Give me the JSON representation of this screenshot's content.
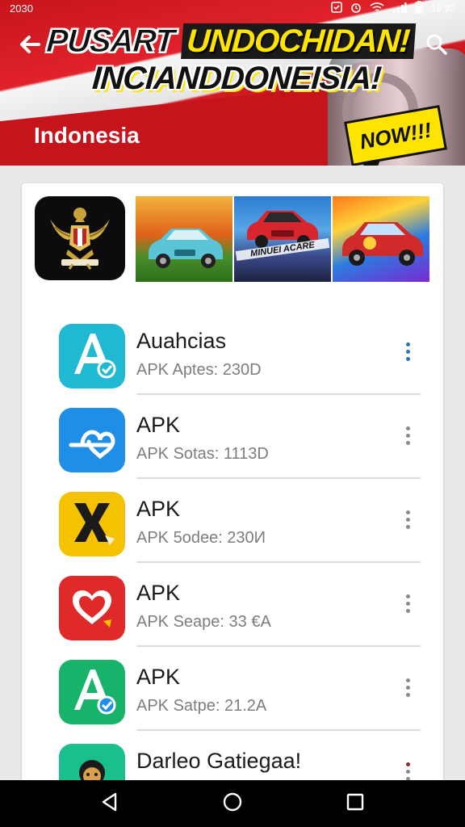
{
  "status": {
    "left_time": "2030",
    "right_time": "19:92",
    "icons": [
      "notification-icon",
      "alarm-icon",
      "wifi-icon",
      "signal-icon",
      "battery-icon"
    ]
  },
  "header": {
    "headline_line1_a": "PUSART",
    "headline_line1_b": "UNDOCHIDAN!",
    "headline_line2": "INCIANDDONEISIA!",
    "badge": "NOW!!!",
    "title": "Indonesia"
  },
  "screenshots": {
    "caption": "MINUEI ACARE"
  },
  "apps": [
    {
      "name": "Auahcias",
      "meta": "APK Aptes: 230D",
      "icon": "letter-a-icon",
      "color": "#1fb9d4"
    },
    {
      "name": "APK",
      "meta": "APK Sotas: 1113D",
      "icon": "heart-link-icon",
      "color": "#1f8ee6"
    },
    {
      "name": "APK",
      "meta": "APK 5odee: 230И",
      "icon": "x-logo-icon",
      "color": "#f5c200"
    },
    {
      "name": "APK",
      "meta": "APK Seape: 33 €A",
      "icon": "heart-icon",
      "color": "#e02a2a"
    },
    {
      "name": "APK",
      "meta": "APK Satpe: 21.2A",
      "icon": "letter-a-icon",
      "color": "#18b36a"
    },
    {
      "name": "Darleo Gatiegaa!",
      "meta": "",
      "icon": "monkey-icon",
      "color": "#19c08e"
    }
  ],
  "colors": {
    "flag_red": "#d11a22",
    "accent_yellow": "#ffe400"
  }
}
